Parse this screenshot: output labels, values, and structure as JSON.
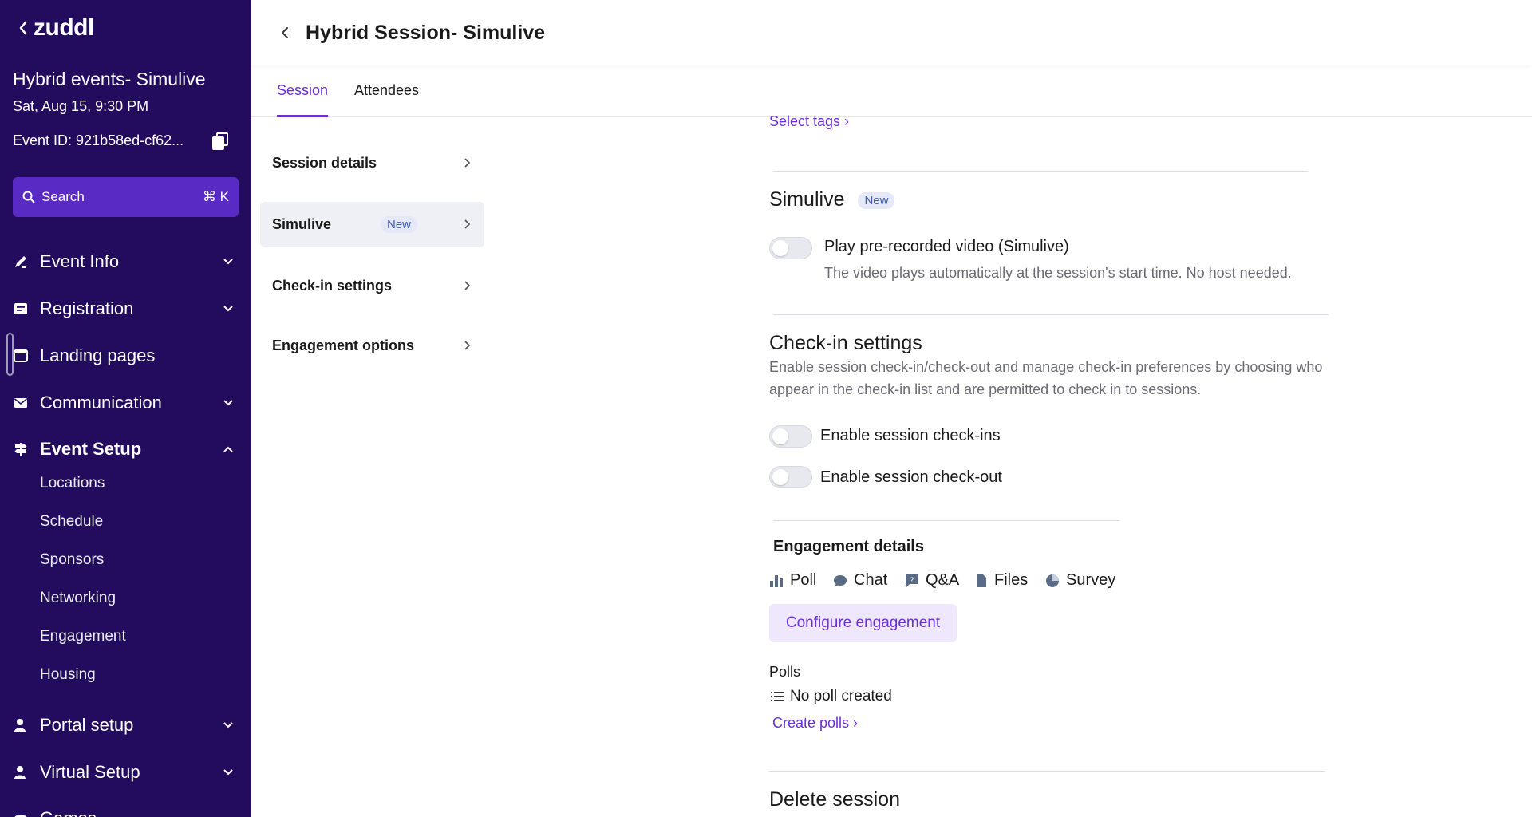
{
  "app": {
    "logo": "zuddl"
  },
  "sidebar": {
    "event_title": "Hybrid events- Simulive",
    "event_date": "Sat, Aug 15, 9:30 PM",
    "event_id": "Event ID: 921b58ed-cf62...",
    "search_label": "Search",
    "search_shortcut": "⌘ K",
    "nav": [
      {
        "label": "Event Info",
        "icon": "pen-ruler-icon"
      },
      {
        "label": "Registration",
        "icon": "form-icon"
      },
      {
        "label": "Landing pages",
        "icon": "browser-icon"
      },
      {
        "label": "Communication",
        "icon": "mail-icon"
      },
      {
        "label": "Event Setup",
        "icon": "signpost-icon"
      },
      {
        "label": "Portal setup",
        "icon": "person-icon"
      },
      {
        "label": "Virtual Setup",
        "icon": "person-icon"
      },
      {
        "label": "Games",
        "icon": "gamepad-icon"
      }
    ],
    "event_setup_items": [
      "Locations",
      "Schedule",
      "Sponsors",
      "Networking",
      "Engagement",
      "Housing"
    ]
  },
  "header": {
    "title": "Hybrid Session- Simulive"
  },
  "tabs": [
    "Session",
    "Attendees"
  ],
  "subnav": [
    {
      "label": "Session details"
    },
    {
      "label": "Simulive",
      "badge": "New"
    },
    {
      "label": "Check-in settings"
    },
    {
      "label": "Engagement options"
    }
  ],
  "main": {
    "select_tags": "Select tags ›",
    "simulive": {
      "title": "Simulive",
      "badge": "New",
      "toggle_label": "Play pre-recorded video (Simulive)",
      "description": "The video plays automatically at the session's start time. No host needed."
    },
    "checkin": {
      "title": "Check-in settings",
      "description": "Enable session check-in/check-out and manage check-in preferences by choosing who appear in the check-in list and are permitted to check in to sessions.",
      "toggle_checkin": "Enable session check-ins",
      "toggle_checkout": "Enable session check-out"
    },
    "engagement": {
      "title": "Engagement details",
      "items": [
        "Poll",
        "Chat",
        "Q&A",
        "Files",
        "Survey"
      ],
      "configure_label": "Configure engagement",
      "polls_label": "Polls",
      "no_poll": "No poll created",
      "create_polls": "Create polls ›"
    },
    "delete_title": "Delete session"
  },
  "colors": {
    "sidebar_bg": "#230b5e",
    "accent": "#6a2fd6",
    "search_bg": "#5a2bc4"
  }
}
